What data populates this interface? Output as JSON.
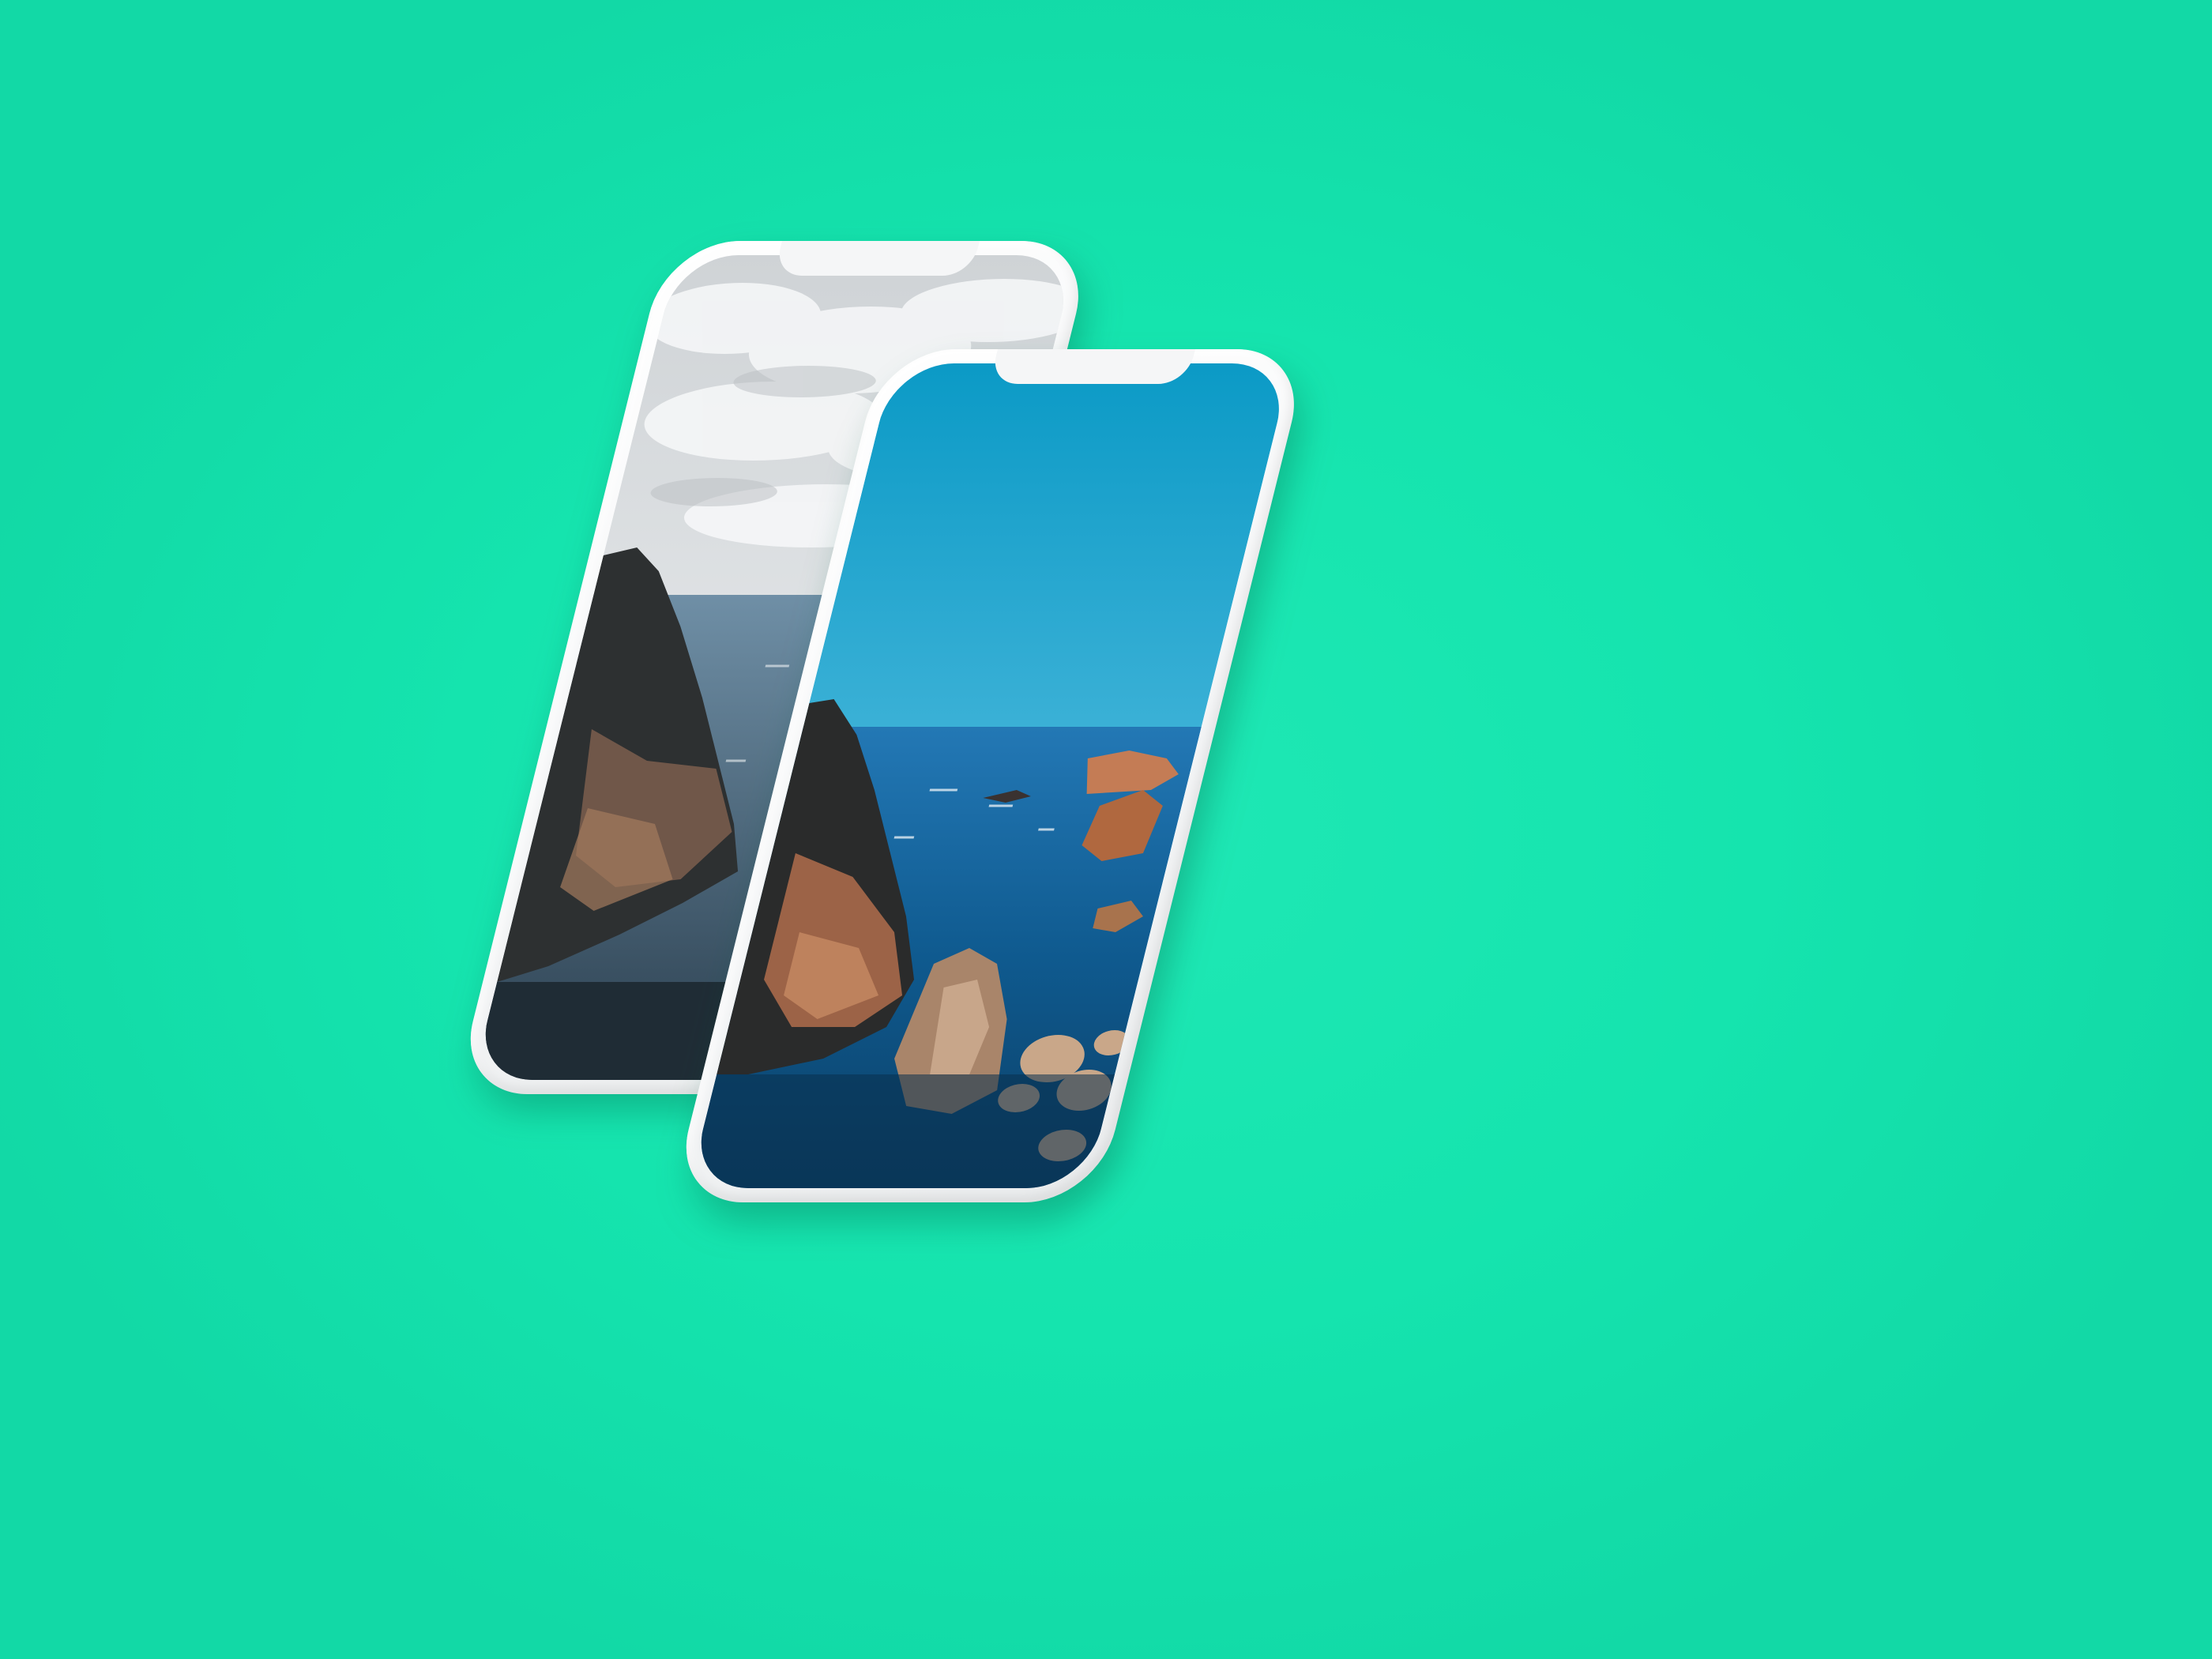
{
  "scene": {
    "background_color": "#16e3ae",
    "device_color": "#f4f5f6"
  },
  "phones": [
    {
      "name": "back-phone",
      "wallpaper": {
        "description_icon": "coastal-cliff-cloudy-photo",
        "sky_colors": [
          "#d9dcde",
          "#eef0f1"
        ],
        "sea_color": "#3f5f78",
        "rock_colors": [
          "#2f3233",
          "#8a6a58"
        ]
      }
    },
    {
      "name": "front-phone",
      "wallpaper": {
        "description_icon": "coastal-cliff-clear-sky-photo",
        "sky_colors": [
          "#0f9fc8",
          "#8fd0e6"
        ],
        "sea_color": "#0f4f86",
        "rock_colors": [
          "#2b2b2a",
          "#b27552"
        ]
      }
    }
  ]
}
